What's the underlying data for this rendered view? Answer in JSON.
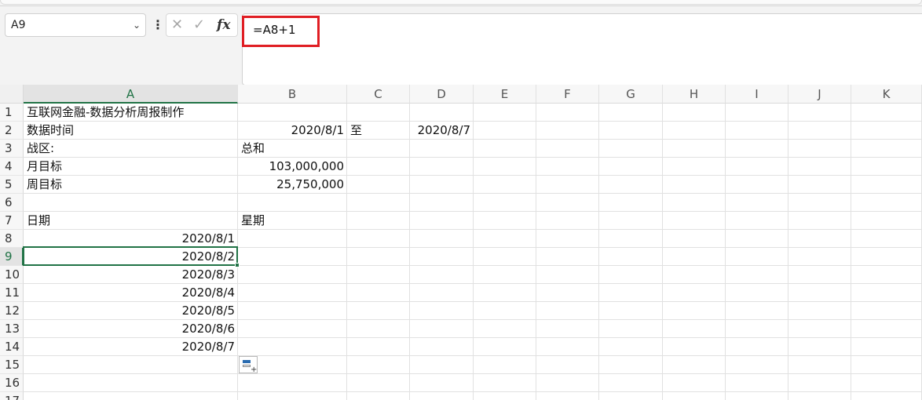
{
  "name_box": {
    "value": "A9"
  },
  "formula_bar": {
    "value": "=A8+1"
  },
  "columns": [
    "A",
    "B",
    "C",
    "D",
    "E",
    "F",
    "G",
    "H",
    "I",
    "J",
    "K"
  ],
  "rows": [
    "1",
    "2",
    "3",
    "4",
    "5",
    "6",
    "7",
    "8",
    "9",
    "10",
    "11",
    "12",
    "13",
    "14",
    "15",
    "16",
    "17"
  ],
  "cells": {
    "A1": "互联网金融-数据分析周报制作",
    "A2": "数据时间",
    "B2": "2020/8/1",
    "C2": "至",
    "D2": "2020/8/7",
    "A3": "战区:",
    "B3": "总和",
    "A4": "月目标",
    "B4": "103,000,000",
    "A5": "周目标",
    "B5": "25,750,000",
    "A7": "日期",
    "B7": "星期",
    "A8": "2020/8/1",
    "A9": "2020/8/2",
    "A10": "2020/8/3",
    "A11": "2020/8/4",
    "A12": "2020/8/5",
    "A13": "2020/8/6",
    "A14": "2020/8/7"
  },
  "active_cell": "A9",
  "accent_color": "#217346",
  "highlight_color": "#e01e24",
  "icons": [
    "chevron-down-icon",
    "more-dots-icon",
    "cancel-icon",
    "confirm-icon",
    "fx-icon",
    "autofill-options-icon"
  ]
}
